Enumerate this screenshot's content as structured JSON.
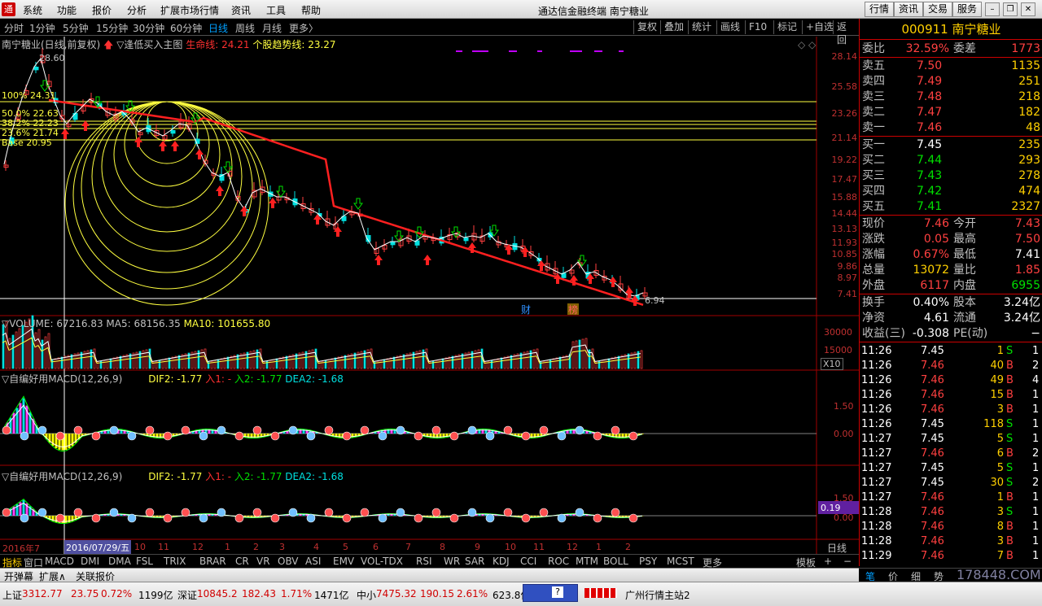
{
  "menu": {
    "items": [
      "系统",
      "功能",
      "报价",
      "分析",
      "扩展市场行情",
      "资讯",
      "工具",
      "帮助"
    ],
    "title": "通达信金融终端  南宁糖业",
    "right_buttons": [
      "行情",
      "资讯",
      "交易",
      "服务"
    ]
  },
  "toolbar": {
    "periods": [
      "分时",
      "1分钟",
      "5分钟",
      "15分钟",
      "30分钟",
      "60分钟",
      "日线",
      "周线",
      "月线",
      "更多〉"
    ],
    "active_period": "日线",
    "tools": [
      "复权",
      "叠加",
      "统计",
      "画线",
      "F10",
      "标记",
      "+自选",
      "返回"
    ]
  },
  "main_chart": {
    "title": "南宁糖业(日线,前复权)",
    "indicator": "▽逢低买入主图",
    "lifeline_label": "生命线:",
    "lifeline_value": "24.21",
    "trend_label": "个股趋势线:",
    "trend_value": "23.27",
    "high_label": "28.60",
    "low_label": "6.94",
    "fib_labels": [
      "100% 24.31",
      "50.0% 22.63",
      "38.2% 22.23",
      "23.6% 21.74",
      "Base 20.95"
    ],
    "y_ticks": [
      "28.14",
      "25.58",
      "23.26",
      "21.14",
      "19.22",
      "17.47",
      "15.88",
      "14.44",
      "13.13",
      "11.93",
      "10.85",
      "9.86",
      "8.97",
      "7.41"
    ],
    "markers": [
      "财",
      "榜"
    ]
  },
  "volume": {
    "label": "▽VOLUME: 67216.83",
    "ma5": "MA5: 68156.35",
    "ma10": "MA10: 101655.80",
    "y_ticks": [
      "30000",
      "15000"
    ],
    "unit": "X10"
  },
  "macd1": {
    "name": "▽自编好用MACD(12,26,9)",
    "dif2": "DIF2: -1.77",
    "in1": "入1: -",
    "in2": "入2: -1.77",
    "dea2": "DEA2: -1.68",
    "y_ticks": [
      "1.50",
      "0.00"
    ]
  },
  "macd2": {
    "name": "▽自编好用MACD(12,26,9)",
    "dif2": "DIF2: -1.77",
    "in1": "入1: -",
    "in2": "入2: -1.77",
    "dea2": "DEA2: -1.68",
    "y_ticks": [
      "1.50",
      "0.00"
    ],
    "current": "0.19"
  },
  "xaxis": {
    "labels": [
      "2016年7",
      "2016/07/29/五",
      "10",
      "11",
      "12",
      "1",
      "2",
      "3",
      "4",
      "5",
      "6",
      "7",
      "8",
      "9",
      "10",
      "11",
      "12",
      "1",
      "2"
    ],
    "period_tag": "日线"
  },
  "ind_tabs": [
    "指标",
    "窗口",
    "MACD",
    "DMI",
    "DMA",
    "FSL",
    "TRIX",
    "BRAR",
    "CR",
    "VR",
    "OBV",
    "ASI",
    "EMV",
    "VOL-TDX",
    "RSI",
    "WR",
    "SAR",
    "KDJ",
    "CCI",
    "ROC",
    "MTM",
    "BOLL",
    "PSY",
    "MCST",
    "更多"
  ],
  "ind_tabs_right": [
    "模板",
    "+",
    "−"
  ],
  "bottom_tabs": [
    "开弹幕",
    "扩展∧",
    "关联报价"
  ],
  "right_panel": {
    "code": "000911",
    "name": "南宁糖业",
    "weibi_label": "委比",
    "weibi": "32.59%",
    "weicha_label": "委差",
    "weicha": "1773",
    "asks": [
      {
        "label": "卖五",
        "price": "7.50",
        "vol": "1135"
      },
      {
        "label": "卖四",
        "price": "7.49",
        "vol": "251"
      },
      {
        "label": "卖三",
        "price": "7.48",
        "vol": "218"
      },
      {
        "label": "卖二",
        "price": "7.47",
        "vol": "182"
      },
      {
        "label": "卖一",
        "price": "7.46",
        "vol": "48"
      }
    ],
    "bids": [
      {
        "label": "买一",
        "price": "7.45",
        "vol": "235"
      },
      {
        "label": "买二",
        "price": "7.44",
        "vol": "293"
      },
      {
        "label": "买三",
        "price": "7.43",
        "vol": "278"
      },
      {
        "label": "买四",
        "price": "7.42",
        "vol": "474"
      },
      {
        "label": "买五",
        "price": "7.41",
        "vol": "2327"
      }
    ],
    "stats": [
      {
        "l1": "现价",
        "v1": "7.46",
        "c1": "red",
        "l2": "今开",
        "v2": "7.43",
        "c2": "red"
      },
      {
        "l1": "涨跌",
        "v1": "0.05",
        "c1": "red",
        "l2": "最高",
        "v2": "7.50",
        "c2": "red"
      },
      {
        "l1": "涨幅",
        "v1": "0.67%",
        "c1": "red",
        "l2": "最低",
        "v2": "7.41",
        "c2": "wht"
      },
      {
        "l1": "总量",
        "v1": "13072",
        "c1": "yel",
        "l2": "量比",
        "v2": "1.85",
        "c2": "red"
      },
      {
        "l1": "外盘",
        "v1": "6117",
        "c1": "red",
        "l2": "内盘",
        "v2": "6955",
        "c2": "grn"
      }
    ],
    "stats2": [
      {
        "l1": "换手",
        "v1": "0.40%",
        "c1": "wht",
        "l2": "股本",
        "v2": "3.24亿",
        "c2": "wht"
      },
      {
        "l1": "净资",
        "v1": "4.61",
        "c1": "wht",
        "l2": "流通",
        "v2": "3.24亿",
        "c2": "wht"
      },
      {
        "l1": "收益(三)",
        "v1": "-0.308",
        "c1": "wht",
        "l2": "PE(动)",
        "v2": "−",
        "c2": "wht"
      }
    ],
    "ticks": [
      {
        "t": "11:26",
        "p": "7.45",
        "v": "1",
        "bs": "S",
        "n": "1"
      },
      {
        "t": "11:26",
        "p": "7.46",
        "v": "40",
        "bs": "B",
        "n": "2"
      },
      {
        "t": "11:26",
        "p": "7.46",
        "v": "49",
        "bs": "B",
        "n": "4"
      },
      {
        "t": "11:26",
        "p": "7.46",
        "v": "15",
        "bs": "B",
        "n": "1"
      },
      {
        "t": "11:26",
        "p": "7.46",
        "v": "3",
        "bs": "B",
        "n": "1"
      },
      {
        "t": "11:26",
        "p": "7.45",
        "v": "118",
        "bs": "S",
        "n": "1"
      },
      {
        "t": "11:27",
        "p": "7.45",
        "v": "5",
        "bs": "S",
        "n": "1"
      },
      {
        "t": "11:27",
        "p": "7.46",
        "v": "6",
        "bs": "B",
        "n": "2"
      },
      {
        "t": "11:27",
        "p": "7.45",
        "v": "5",
        "bs": "S",
        "n": "1"
      },
      {
        "t": "11:27",
        "p": "7.45",
        "v": "30",
        "bs": "S",
        "n": "2"
      },
      {
        "t": "11:27",
        "p": "7.46",
        "v": "1",
        "bs": "B",
        "n": "1"
      },
      {
        "t": "11:28",
        "p": "7.46",
        "v": "3",
        "bs": "S",
        "n": "1"
      },
      {
        "t": "11:28",
        "p": "7.46",
        "v": "8",
        "bs": "B",
        "n": "1"
      },
      {
        "t": "11:28",
        "p": "7.46",
        "v": "3",
        "bs": "B",
        "n": "1"
      },
      {
        "t": "11:29",
        "p": "7.46",
        "v": "7",
        "bs": "B",
        "n": "1"
      }
    ],
    "bottom_tabs": [
      "笔",
      "价",
      "细",
      "势"
    ]
  },
  "status": {
    "sh_label": "上证",
    "sh_index": "3312.77",
    "sh_chg": "23.75",
    "sh_pct": "0.72%",
    "sh_amt": "1199亿",
    "sz_label": "深证",
    "sz_index": "10845.2",
    "sz_chg": "182.43",
    "sz_pct": "1.71%",
    "sz_amt": "1471亿",
    "zx_label": "中小",
    "zx_index": "7475.32",
    "zx_chg": "190.15",
    "zx_pct": "2.61%",
    "zx_amt": "623.8亿",
    "server": "广州行情主站2",
    "watermark": "178448.COM"
  },
  "colors": {
    "up": "#ff4040",
    "down": "#00e0e0",
    "lifeline": "#ff2020",
    "fib": "#ffff40",
    "accent": "#00a0ff"
  }
}
